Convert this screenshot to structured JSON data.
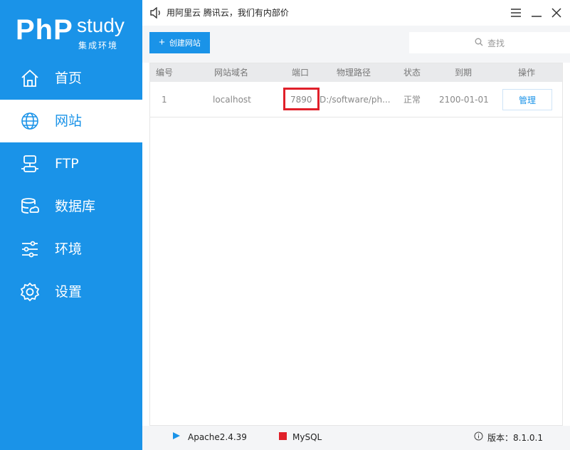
{
  "logo": {
    "main": "PhP",
    "study": "study",
    "subtitle": "集成环境"
  },
  "nav": [
    {
      "label": "首页",
      "icon": "home-icon"
    },
    {
      "label": "网站",
      "icon": "globe-icon",
      "active": true
    },
    {
      "label": "FTP",
      "icon": "ftp-server-icon"
    },
    {
      "label": "数据库",
      "icon": "database-icon"
    },
    {
      "label": "环境",
      "icon": "sliders-icon"
    },
    {
      "label": "设置",
      "icon": "gear-icon"
    }
  ],
  "topbar": {
    "ad_text": "用阿里云 腾讯云，我们有内部价"
  },
  "toolbar": {
    "create_label": "创建网站",
    "search_placeholder": "查找"
  },
  "table": {
    "headers": [
      "编号",
      "网站域名",
      "端口",
      "物理路径",
      "状态",
      "到期",
      "操作"
    ],
    "rows": [
      {
        "id": "1",
        "domain": "localhost",
        "port": "7890",
        "path": "D:/software/ph...",
        "status": "正常",
        "expire": "2100-01-01",
        "action": "管理"
      }
    ]
  },
  "statusbar": {
    "apache": "Apache2.4.39",
    "mysql": "MySQL",
    "version": "版本：8.1.0.1"
  },
  "colors": {
    "accent": "#1a93e8",
    "highlight_box": "#e0202a",
    "mysql_stopped": "#e0202a"
  }
}
